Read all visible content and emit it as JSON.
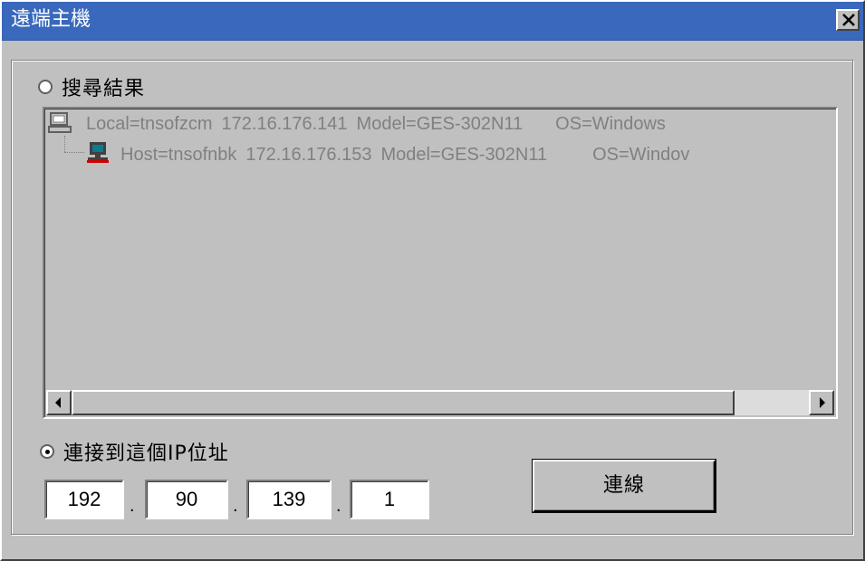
{
  "window": {
    "title": "遠端主機",
    "close_glyph": "✕"
  },
  "search_results": {
    "label": "搜尋結果",
    "selected": false,
    "rows": [
      {
        "icon": "local-computer-icon",
        "host": "Local=tnsofzcm",
        "ip": "172.16.176.141",
        "model": "Model=GES-302N11",
        "os": "OS=Windows"
      },
      {
        "icon": "host-computer-icon",
        "host": "Host=tnsofnbk",
        "ip": "172.16.176.153",
        "model": "Model=GES-302N11",
        "os": "OS=Windov"
      }
    ]
  },
  "direct_ip": {
    "label": "連接到這個IP位址",
    "selected": true,
    "octets": [
      "192",
      "90",
      "139",
      "1"
    ],
    "separator": "."
  },
  "connect_button": {
    "label": "連線"
  },
  "colors": {
    "titlebar": "#3a68bc",
    "face": "#c0c0c0",
    "disabled_text": "#808080"
  }
}
